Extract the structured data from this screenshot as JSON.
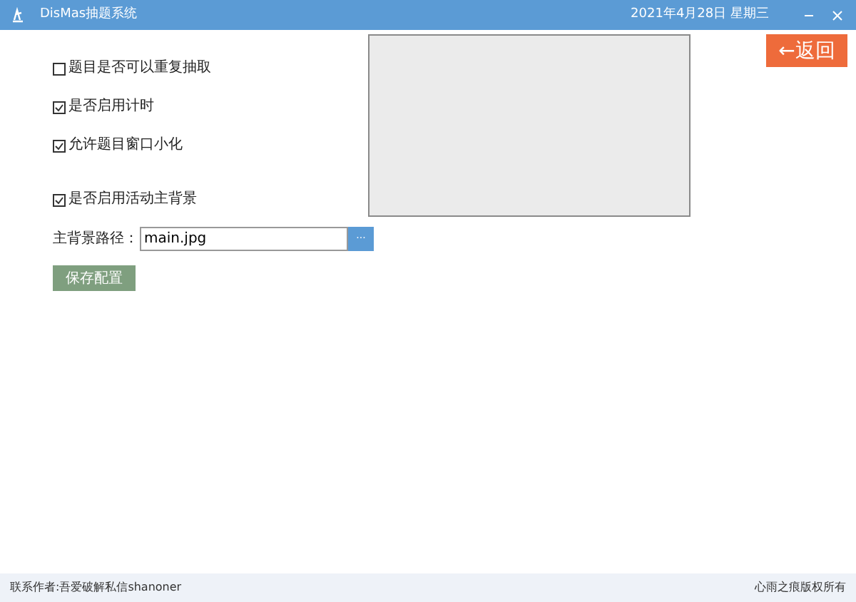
{
  "window": {
    "title": "DisMas抽题系统",
    "date": "2021年4月28日 星期三"
  },
  "back_button": {
    "label": "←返回"
  },
  "options": [
    {
      "label": "题目是否可以重复抽取",
      "checked": false
    },
    {
      "label": "是否启用计时",
      "checked": true
    },
    {
      "label": "允许题目窗口小化",
      "checked": true
    },
    {
      "label": "是否启用活动主背景",
      "checked": true
    }
  ],
  "background_path": {
    "label": "主背景路径：",
    "value": "main.jpg",
    "browse": "···"
  },
  "save_button": {
    "label": "保存配置"
  },
  "status_bar": {
    "left": "联系作者:吾爱破解私信shanoner",
    "right": "心雨之痕版权所有"
  }
}
